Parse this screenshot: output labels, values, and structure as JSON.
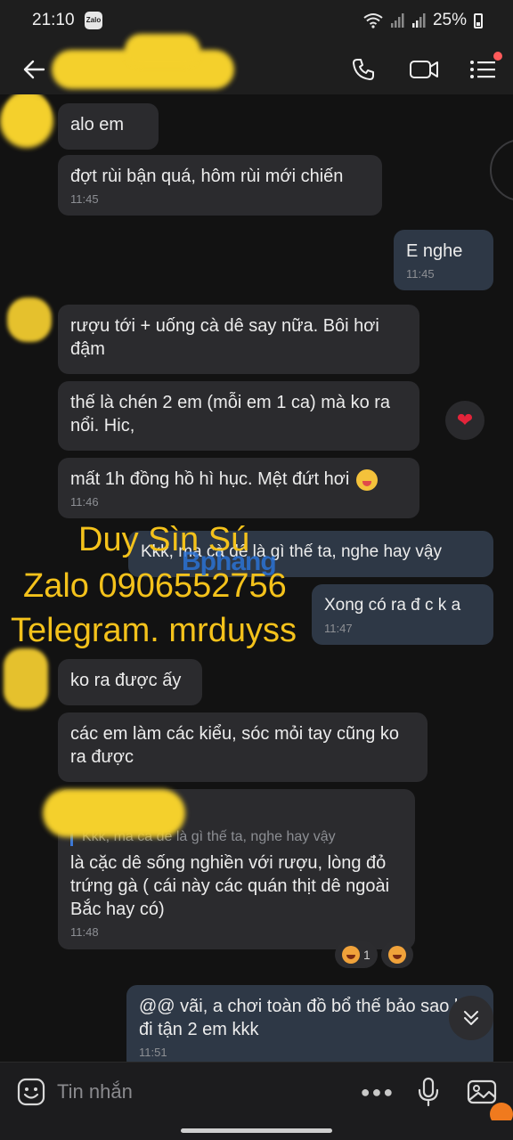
{
  "status_bar": {
    "time": "21:10",
    "app_badge": "Zalo",
    "battery": "25%"
  },
  "header": {
    "title": ""
  },
  "messages": [
    {
      "text": "alo em",
      "time": ""
    },
    {
      "text": "đợt rùi bận quá, hôm rùi mới chiến",
      "time": "11:45"
    },
    {
      "text": "E nghe",
      "time": "11:45"
    },
    {
      "text": "rượu tới + uống cà dê say nữa. Bôi hơi đậm",
      "time": ""
    },
    {
      "text": "thế là chén 2 em (mỗi em 1 ca) mà ko ra nổi. Hic,",
      "time": ""
    },
    {
      "text": "mất 1h đồng hồ hì hục. Mệt đứt hơi",
      "time": "11:46"
    },
    {
      "text": "Kkk, ma cà dê là gì thế ta, nghe hay vậy",
      "time": ""
    },
    {
      "text": "Xong có ra đ c k a",
      "time": "11:47"
    },
    {
      "text": "ko ra được ấy",
      "time": ""
    },
    {
      "text": "các em làm các kiểu, sóc mỏi tay cũng ko ra được",
      "time": ""
    },
    {
      "quote": "Kkk, ma cà dê là gì thế ta, nghe hay vậy",
      "text": "là cặc dê sống nghiền với rượu, lòng đỏ trứng gà ( cái này các quán thịt dê ngoài Bắc hay có)",
      "time": "11:48"
    },
    {
      "text": "@@ vãi, a chơi toàn đồ bổ thế bảo sao ko đi tận 2 em kkk",
      "time": "11:51"
    }
  ],
  "reactions": {
    "heart": "❤",
    "laugh_count": "1"
  },
  "watermark": {
    "line1": "Duy Sìn Sú",
    "line2": "Zalo 0906552756",
    "line3": "Telegram. mrduyss",
    "logo": "Bphang"
  },
  "input": {
    "placeholder": "Tin nhắn"
  }
}
